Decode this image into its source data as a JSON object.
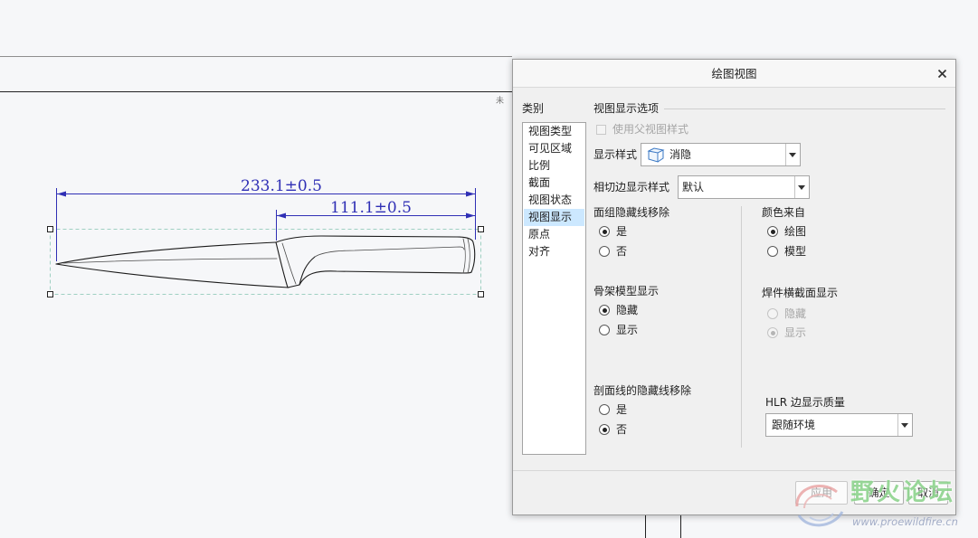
{
  "colors": {
    "dimension": "#2f2fb5",
    "selection": "#cce8ff",
    "watermark": "#8ed48e"
  },
  "drawing": {
    "note_fragment": "未",
    "dimensions": [
      "233.1±0.5",
      "111.1±0.5"
    ]
  },
  "dialog": {
    "title": "绘图视图",
    "close_icon": "close-icon",
    "category_label": "类别",
    "categories": [
      {
        "label": "视图类型",
        "selected": false
      },
      {
        "label": "可见区域",
        "selected": false
      },
      {
        "label": "比例",
        "selected": false
      },
      {
        "label": "截面",
        "selected": false
      },
      {
        "label": "视图状态",
        "selected": false
      },
      {
        "label": "视图显示",
        "selected": true
      },
      {
        "label": "原点",
        "selected": false
      },
      {
        "label": "对齐",
        "selected": false
      }
    ],
    "options_header": "视图显示选项",
    "use_parent_style": {
      "label": "使用父视图样式",
      "checked": false,
      "disabled": true
    },
    "display_style": {
      "label": "显示样式",
      "value": "消隐",
      "icon": "hidden-line-cube-icon"
    },
    "tangent_edge_style": {
      "label": "相切边显示样式",
      "value": "默认"
    },
    "quilt_hidden_line_removal": {
      "label": "面组隐藏线移除",
      "options": [
        {
          "label": "是",
          "checked": true
        },
        {
          "label": "否",
          "checked": false
        }
      ]
    },
    "color_from": {
      "label": "颜色来自",
      "options": [
        {
          "label": "绘图",
          "checked": true
        },
        {
          "label": "模型",
          "checked": false
        }
      ]
    },
    "skeleton_model_display": {
      "label": "骨架模型显示",
      "options": [
        {
          "label": "隐藏",
          "checked": true
        },
        {
          "label": "显示",
          "checked": false
        }
      ]
    },
    "weld_xsec_display": {
      "label": "焊件横截面显示",
      "disabled": true,
      "options": [
        {
          "label": "隐藏",
          "checked": false
        },
        {
          "label": "显示",
          "checked": true
        }
      ]
    },
    "xhatch_hidden_line_removal": {
      "label": "剖面线的隐藏线移除",
      "options": [
        {
          "label": "是",
          "checked": false
        },
        {
          "label": "否",
          "checked": true
        }
      ]
    },
    "hlr_edge_quality": {
      "label": "HLR 边显示质量",
      "value": "跟随环境"
    },
    "buttons": {
      "apply": {
        "label": "应用",
        "disabled": true
      },
      "ok": {
        "label": "确定"
      },
      "cancel": {
        "label": "取消"
      }
    }
  },
  "watermark": {
    "title": "野火论坛",
    "url": "www.proewildfire.cn",
    "logo_icon": "forum-logo-icon"
  }
}
